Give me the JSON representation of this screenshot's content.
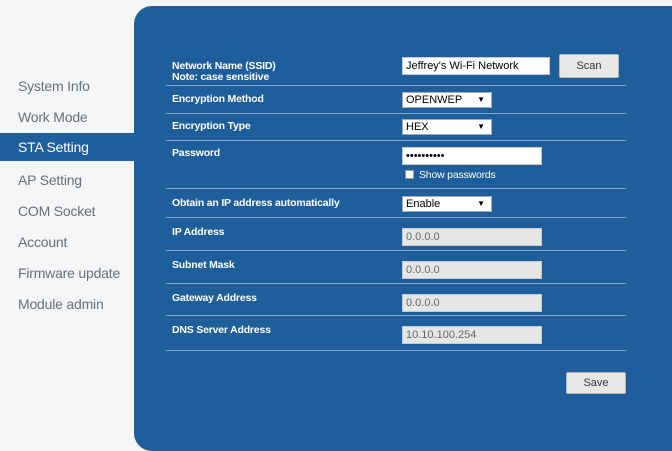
{
  "sidebar": {
    "items": [
      {
        "label": "System Info"
      },
      {
        "label": "Work Mode"
      },
      {
        "label": "STA Setting",
        "active": true
      },
      {
        "label": "AP Setting"
      },
      {
        "label": "COM Socket"
      },
      {
        "label": "Account"
      },
      {
        "label": "Firmware update"
      },
      {
        "label": "Module admin"
      }
    ]
  },
  "form": {
    "ssid": {
      "label": "Network Name (SSID)",
      "note": "Note: case sensitive",
      "value": "Jeffrey's Wi-Fi Network",
      "scan_label": "Scan"
    },
    "encryption_method": {
      "label": "Encryption Method",
      "value": "OPENWEP"
    },
    "encryption_type": {
      "label": "Encryption Type",
      "value": "HEX"
    },
    "password": {
      "label": "Password",
      "value": "••••••••••",
      "show_label": "Show passwords"
    },
    "dhcp": {
      "label": "Obtain an IP address automatically",
      "value": "Enable"
    },
    "ip": {
      "label": "IP Address",
      "value": "0.0.0.0"
    },
    "subnet": {
      "label": "Subnet Mask",
      "value": "0.0.0.0"
    },
    "gateway": {
      "label": "Gateway Address",
      "value": "0.0.0.0"
    },
    "dns": {
      "label": "DNS Server Address",
      "value": "10.10.100.254"
    },
    "save_label": "Save"
  },
  "colors": {
    "panel": "#1e5e9b",
    "active_nav": "#1f5f9c",
    "nav_text": "#6a7078"
  }
}
